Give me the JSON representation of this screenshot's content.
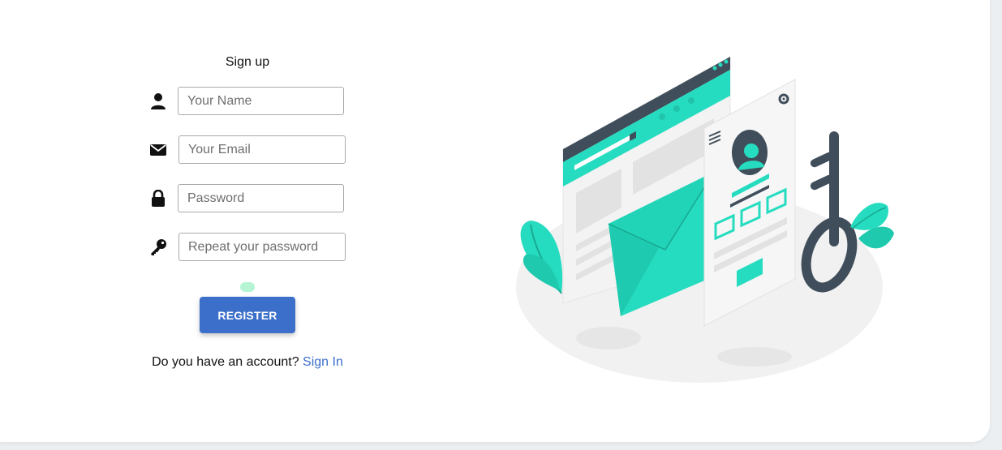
{
  "form": {
    "title": "Sign up",
    "fields": [
      {
        "name": "name",
        "placeholder": "Your Name",
        "icon": "person-icon"
      },
      {
        "name": "email",
        "placeholder": "Your Email",
        "icon": "envelope-icon"
      },
      {
        "name": "password",
        "placeholder": "Password",
        "icon": "lock-icon"
      },
      {
        "name": "repeat_password",
        "placeholder": "Repeat your password",
        "icon": "key-icon"
      }
    ],
    "register_label": "REGISTER",
    "account_prompt": "Do you have an account?",
    "signin_label": "Sign In"
  },
  "colors": {
    "accent": "#3b6fc9",
    "teal": "#26dcc0",
    "dark": "#3f4e5a",
    "illustration_bg": "#f1f1f1"
  }
}
